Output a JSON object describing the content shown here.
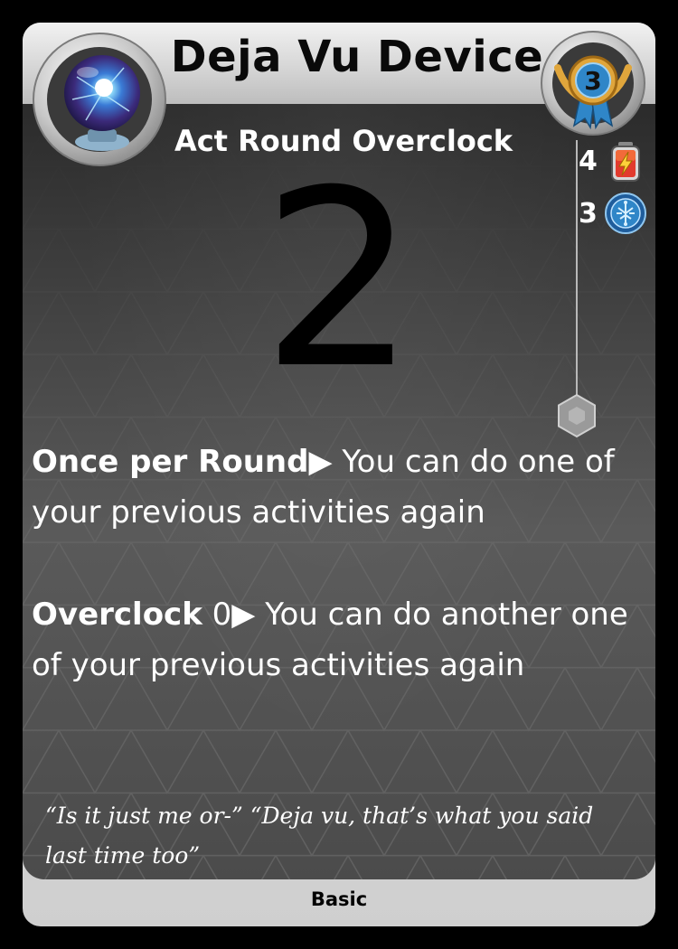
{
  "card": {
    "title": "Deja Vu Device",
    "subtitle": "Act Round Overclock",
    "big_number": "2",
    "level": "3",
    "stats": [
      {
        "value": "4",
        "icon": "battery-icon"
      },
      {
        "value": "3",
        "icon": "circuit-coin-icon"
      }
    ],
    "rules": [
      {
        "keyword": "Once per Round",
        "suffix": "",
        "arrow": "▶",
        "text": " You can do one of your previous activities again"
      },
      {
        "keyword": "Overclock",
        "suffix": " 0",
        "arrow": "▶",
        "text": " You can do another one of your previous activities again"
      }
    ],
    "flavor": "“Is it just me or-” “Deja vu, that’s what you said last time too”",
    "rarity": "Basic"
  },
  "colors": {
    "panel": "#3e3e3e",
    "frame": "#d9d9d9",
    "orb_glow": "#5ad0ff",
    "medal_gold": "#e0a63c",
    "medal_blue": "#2f86c8",
    "battery_red": "#e23b2e"
  },
  "icons": {
    "emblem": "plasma-orb-icon",
    "level_badge": "medal-icon",
    "socket": "hexagon-icon"
  }
}
